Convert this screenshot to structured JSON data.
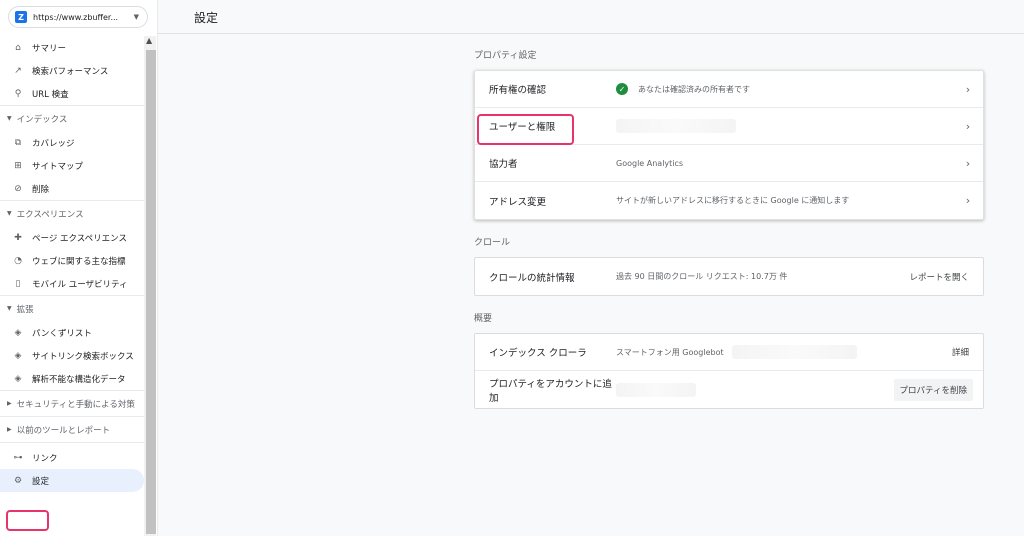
{
  "sidebar": {
    "property_url": "https://www.zbuffer...",
    "items": [
      {
        "icon": "home-icon",
        "glyph": "⌂",
        "label": "サマリー"
      },
      {
        "icon": "trending-icon",
        "glyph": "↗",
        "label": "検索パフォーマンス"
      },
      {
        "icon": "search-icon",
        "glyph": "⚲",
        "label": "URL 検査"
      }
    ],
    "sections": [
      {
        "label": "インデックス",
        "expanded": true,
        "items": [
          {
            "icon": "coverage-icon",
            "glyph": "⧉",
            "label": "カバレッジ"
          },
          {
            "icon": "sitemap-icon",
            "glyph": "⊞",
            "label": "サイトマップ"
          },
          {
            "icon": "removal-icon",
            "glyph": "⊘",
            "label": "削除"
          }
        ]
      },
      {
        "label": "エクスペリエンス",
        "expanded": true,
        "items": [
          {
            "icon": "page-experience-icon",
            "glyph": "✚",
            "label": "ページ エクスペリエンス"
          },
          {
            "icon": "speed-icon",
            "glyph": "◔",
            "label": "ウェブに関する主な指標"
          },
          {
            "icon": "mobile-icon",
            "glyph": "▯",
            "label": "モバイル ユーザビリティ"
          }
        ]
      },
      {
        "label": "拡張",
        "expanded": true,
        "items": [
          {
            "icon": "layers-icon",
            "glyph": "◈",
            "label": "パンくずリスト"
          },
          {
            "icon": "layers-icon",
            "glyph": "◈",
            "label": "サイトリンク検索ボックス"
          },
          {
            "icon": "layers-icon",
            "glyph": "◈",
            "label": "解析不能な構造化データ"
          }
        ]
      },
      {
        "label": "セキュリティと手動による対策",
        "expanded": false,
        "items": []
      },
      {
        "label": "以前のツールとレポート",
        "expanded": false,
        "items": []
      }
    ],
    "bottom_items": [
      {
        "icon": "links-icon",
        "glyph": "⊶",
        "label": "リンク"
      },
      {
        "icon": "gear-icon",
        "glyph": "⚙",
        "label": "設定"
      }
    ]
  },
  "main": {
    "title": "設定",
    "property_settings": {
      "title": "プロパティ設定",
      "rows": [
        {
          "label": "所有権の確認",
          "value": "あなたは確認済みの所有者です"
        },
        {
          "label": "ユーザーと権限",
          "value": ""
        },
        {
          "label": "協力者",
          "value": "Google Analytics"
        },
        {
          "label": "アドレス変更",
          "value": "サイトが新しいアドレスに移行するときに Google に通知します"
        }
      ]
    },
    "crawl": {
      "title": "クロール",
      "row": {
        "label": "クロールの統計情報",
        "value": "過去 90 日間のクロール リクエスト: 10.7万 件",
        "action": "レポートを開く"
      }
    },
    "about": {
      "title": "概要",
      "rows": [
        {
          "label": "インデックス クローラ",
          "value": "スマートフォン用 Googlebot",
          "action": "詳細"
        },
        {
          "label": "プロパティをアカウントに追加",
          "value": "",
          "action": "プロパティを削除"
        }
      ]
    }
  }
}
